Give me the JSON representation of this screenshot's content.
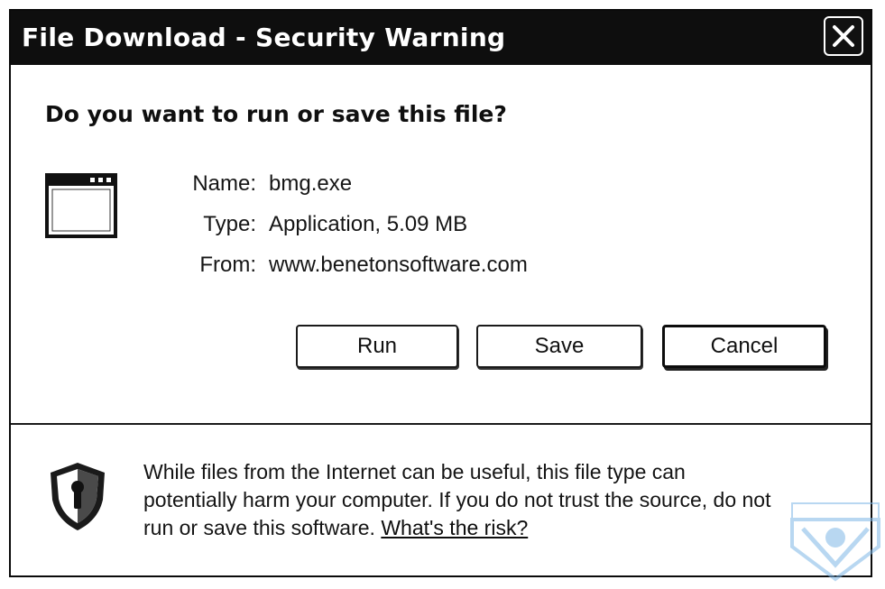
{
  "window": {
    "title": "File Download - Security Warning",
    "close_icon": "close-icon"
  },
  "prompt": {
    "question": "Do you want to run or save this file?",
    "file_icon": "application-window-icon"
  },
  "file_info": {
    "name_label": "Name:",
    "name_value": "bmg.exe",
    "type_label": "Type:",
    "type_value": "Application, 5.09 MB",
    "from_label": "From:",
    "from_value": "www.benetonsoftware.com"
  },
  "buttons": {
    "run_label": "Run",
    "save_label": "Save",
    "cancel_label": "Cancel"
  },
  "warning": {
    "shield_icon": "security-shield-icon",
    "line1": "While files from the Internet can be useful, this file type can",
    "line2": "potentially harm your computer. If you do not trust the source, do not",
    "line3_prefix": "run or save this software. ",
    "risk_link_label": "What's the risk?"
  },
  "colors": {
    "titlebar_bg": "#0e0e0e",
    "title_text": "#ffffff",
    "dialog_bg": "#ffffff",
    "watermark_blue": "#7fb8e6"
  },
  "watermark": {
    "icon": "brand-watermark-icon"
  }
}
